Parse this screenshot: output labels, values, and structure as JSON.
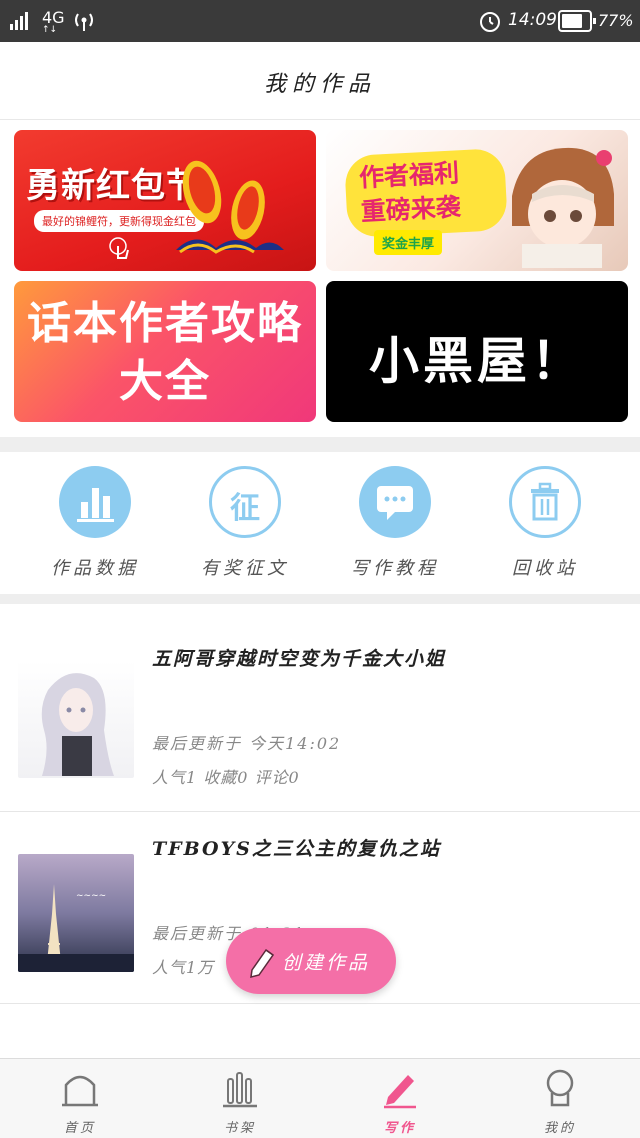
{
  "status_bar": {
    "network": "4G",
    "time": "14:09",
    "battery": "77%",
    "battery_level": 0.77
  },
  "header": {
    "title": "我的作品"
  },
  "banners": [
    {
      "headline": "勇新红包节",
      "sub": "最好的锦鲤符，更新得现金红包"
    },
    {
      "headline": "作者福利\n重磅来袭",
      "tag": "奖金丰厚"
    },
    {
      "headline": "话本作者攻略\n大全"
    },
    {
      "headline": "小黑屋！"
    }
  ],
  "quick_actions": [
    {
      "label": "作品数据",
      "icon": "bar-chart-icon",
      "glyph": ""
    },
    {
      "label": "有奖征文",
      "icon": "contest-icon",
      "glyph": "征"
    },
    {
      "label": "写作教程",
      "icon": "chat-bubble-icon",
      "glyph": ""
    },
    {
      "label": "回收站",
      "icon": "trash-icon",
      "glyph": ""
    }
  ],
  "works": [
    {
      "title": "五阿哥穿越时空变为千金大小姐",
      "updated": "最后更新于 今天14:02",
      "stats": "人气1 收藏0 评论0"
    },
    {
      "title": "TFBOYS之三公主的复仇之站",
      "updated": "最后更新于 01-31",
      "stats": "人气1万"
    }
  ],
  "fab": {
    "label": "创建作品"
  },
  "nav": [
    {
      "label": "首页",
      "icon": "home-icon"
    },
    {
      "label": "书架",
      "icon": "bookshelf-icon"
    },
    {
      "label": "写作",
      "icon": "pen-icon",
      "active": true
    },
    {
      "label": "我的",
      "icon": "profile-icon"
    }
  ],
  "colors": {
    "accent": "#f46fa7",
    "icon_blue": "#8dccf0"
  }
}
